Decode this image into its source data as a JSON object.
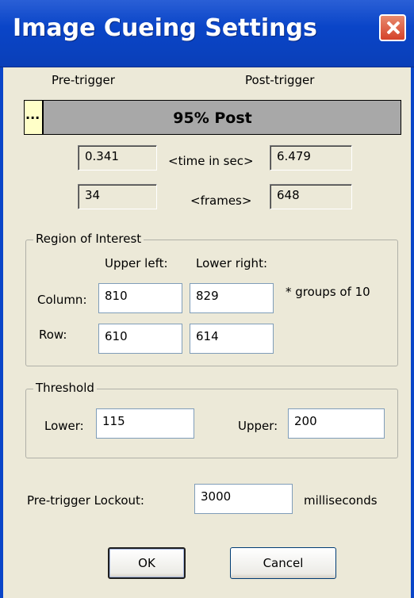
{
  "window": {
    "title": "Image Cueing Settings",
    "close_label": ""
  },
  "trigger": {
    "pre_label": "Pre-trigger",
    "post_label": "Post-trigger",
    "bar_text": "95% Post",
    "post_percent": 95,
    "pre_marker": "...",
    "time_label": "<time in sec>",
    "frames_label": "<frames>",
    "pre_time": "0.341",
    "post_time": "6.479",
    "pre_frames": "34",
    "post_frames": "648"
  },
  "roi": {
    "title": "Region of Interest",
    "upper_left_label": "Upper left:",
    "lower_right_label": "Lower right:",
    "column_label": "Column:",
    "row_label": "Row:",
    "note": "* groups of 10",
    "column_upper_left": "810",
    "column_lower_right": "829",
    "row_upper_left": "610",
    "row_lower_right": "614"
  },
  "threshold": {
    "title": "Threshold",
    "lower_label": "Lower:",
    "lower_value": "115",
    "upper_label": "Upper:",
    "upper_value": "200"
  },
  "lockout": {
    "label": "Pre-trigger Lockout:",
    "value": "3000",
    "unit": "milliseconds"
  },
  "buttons": {
    "ok": "OK",
    "cancel": "Cancel"
  },
  "colors": {
    "titlebar": "#0a45c8",
    "pre_fill": "#ffffc8",
    "post_fill": "#a8a8a8",
    "dialog_bg": "#ece9d8"
  }
}
